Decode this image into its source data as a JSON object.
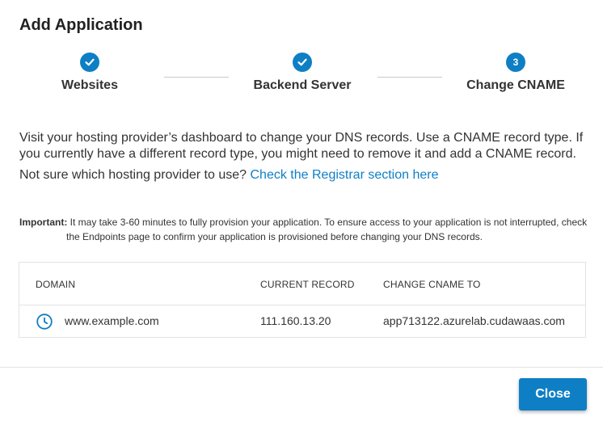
{
  "dialog": {
    "title": "Add Application"
  },
  "stepper": {
    "steps": [
      {
        "label": "Websites",
        "state": "complete",
        "icon": "check-icon"
      },
      {
        "label": "Backend Server",
        "state": "complete",
        "icon": "check-icon"
      },
      {
        "label": "Change CNAME",
        "state": "current",
        "number": "3"
      }
    ]
  },
  "content": {
    "description": "Visit your hosting provider’s dashboard to change your DNS records. Use a CNAME record type. If you currently have a different record type, you might need to remove it and add a CNAME record.",
    "help_text": "Not sure which hosting provider to use?",
    "help_link": "Check the Registrar section here",
    "important_label": "Important:",
    "important_text_1": "It may take 3-60 minutes to fully provision your application. To ensure access to your application is not interrupted, check",
    "important_text_2": "the Endpoints page to confirm your application is provisioned before changing your DNS records."
  },
  "table": {
    "columns": [
      "DOMAIN",
      "CURRENT RECORD",
      "CHANGE CNAME TO"
    ],
    "rows": [
      {
        "status_icon": "clock-icon",
        "domain": "www.example.com",
        "current_record": "111.160.13.20",
        "change_cname_to": "app713122.azurelab.cudawaas.com"
      }
    ]
  },
  "footer": {
    "close_label": "Close"
  },
  "colors": {
    "accent": "#0e7fc4",
    "text": "#333333",
    "divider": "#e3e3e3"
  }
}
